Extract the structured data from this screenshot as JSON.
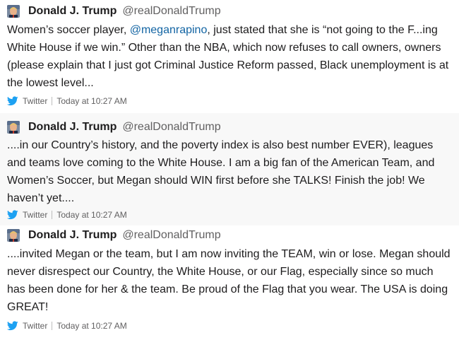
{
  "tweets": [
    {
      "name": "Donald J. Trump",
      "handle": "@realDonaldTrump",
      "text_before_mention": "Women’s soccer player, ",
      "mention": "@meganrapino",
      "text_after_mention": ", just stated that she is “not going to the F...ing White House if we win.” Other than the NBA, which now refuses to call owners, owners (please explain that I just got Criminal Justice Reform passed, Black unemployment is at the lowest level...",
      "source": "Twitter",
      "time": "Today at 10:27 AM"
    },
    {
      "name": "Donald J. Trump",
      "handle": "@realDonaldTrump",
      "text": "....in our Country’s history, and the poverty index is also best number EVER), leagues and teams love coming to the White House. I am a big fan of the American Team, and Women’s Soccer, but Megan should WIN first before she TALKS! Finish the job! We haven’t yet....",
      "source": "Twitter",
      "time": "Today at 10:27 AM"
    },
    {
      "name": "Donald J. Trump",
      "handle": "@realDonaldTrump",
      "text": "....invited Megan or the team, but I am now inviting the TEAM, win or lose. Megan should never disrespect our Country, the White House, or our Flag, especially since so much has been done for her & the team. Be proud of the Flag that you wear. The USA is doing GREAT!",
      "source": "Twitter",
      "time": "Today at 10:27 AM"
    }
  ],
  "colors": {
    "twitter_blue": "#1da1f2",
    "mention_blue": "#1264a3",
    "shaded_background": "#f8f8f8"
  },
  "icons": {
    "avatar": "avatar-photo",
    "source": "twitter-bird-icon"
  }
}
